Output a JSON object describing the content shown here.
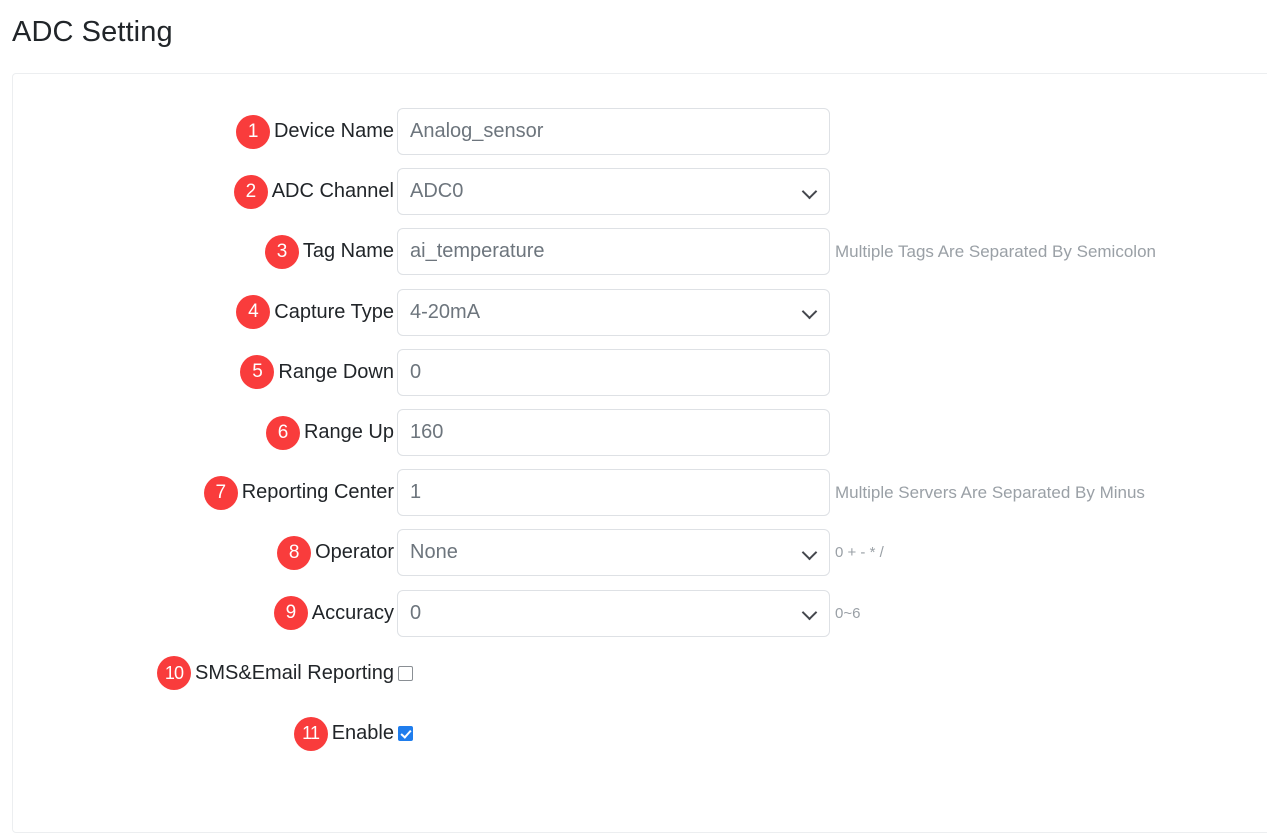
{
  "page": {
    "title": "ADC Setting"
  },
  "form": {
    "rows": [
      {
        "badge": "1",
        "label": "Device Name",
        "control": "text",
        "value": "Analog_sensor",
        "hint": "",
        "name": "device-name"
      },
      {
        "badge": "2",
        "label": "ADC Channel",
        "control": "select",
        "value": "ADC0",
        "hint": "",
        "name": "adc-channel"
      },
      {
        "badge": "3",
        "label": "Tag Name",
        "control": "text",
        "value": "ai_temperature",
        "hint": "Multiple Tags Are Separated By Semicolon",
        "name": "tag-name"
      },
      {
        "badge": "4",
        "label": "Capture Type",
        "control": "select",
        "value": "4-20mA",
        "hint": "",
        "name": "capture-type"
      },
      {
        "badge": "5",
        "label": "Range Down",
        "control": "text",
        "value": "0",
        "hint": "",
        "name": "range-down"
      },
      {
        "badge": "6",
        "label": "Range Up",
        "control": "text",
        "value": "160",
        "hint": "",
        "name": "range-up"
      },
      {
        "badge": "7",
        "label": "Reporting Center",
        "control": "text",
        "value": "1",
        "hint": "Multiple Servers Are Separated By Minus",
        "name": "reporting-center"
      },
      {
        "badge": "8",
        "label": "Operator",
        "control": "select",
        "value": "None",
        "hint": "0 + - * /",
        "name": "operator"
      },
      {
        "badge": "9",
        "label": "Accuracy",
        "control": "select",
        "value": "0",
        "hint": "0~6",
        "name": "accuracy"
      },
      {
        "badge": "10",
        "label": "SMS&Email Reporting",
        "control": "checkbox",
        "checked": false,
        "hint": "",
        "name": "sms-email-reporting"
      },
      {
        "badge": "11",
        "label": "Enable",
        "control": "checkbox",
        "checked": true,
        "hint": "",
        "name": "enable"
      }
    ]
  },
  "colors": {
    "badge_red": "#f93c3c",
    "checkbox_blue": "#1f7ded",
    "field_border": "#dee1e5",
    "hint_text": "#9aa0a6",
    "label_text": "#212529"
  }
}
